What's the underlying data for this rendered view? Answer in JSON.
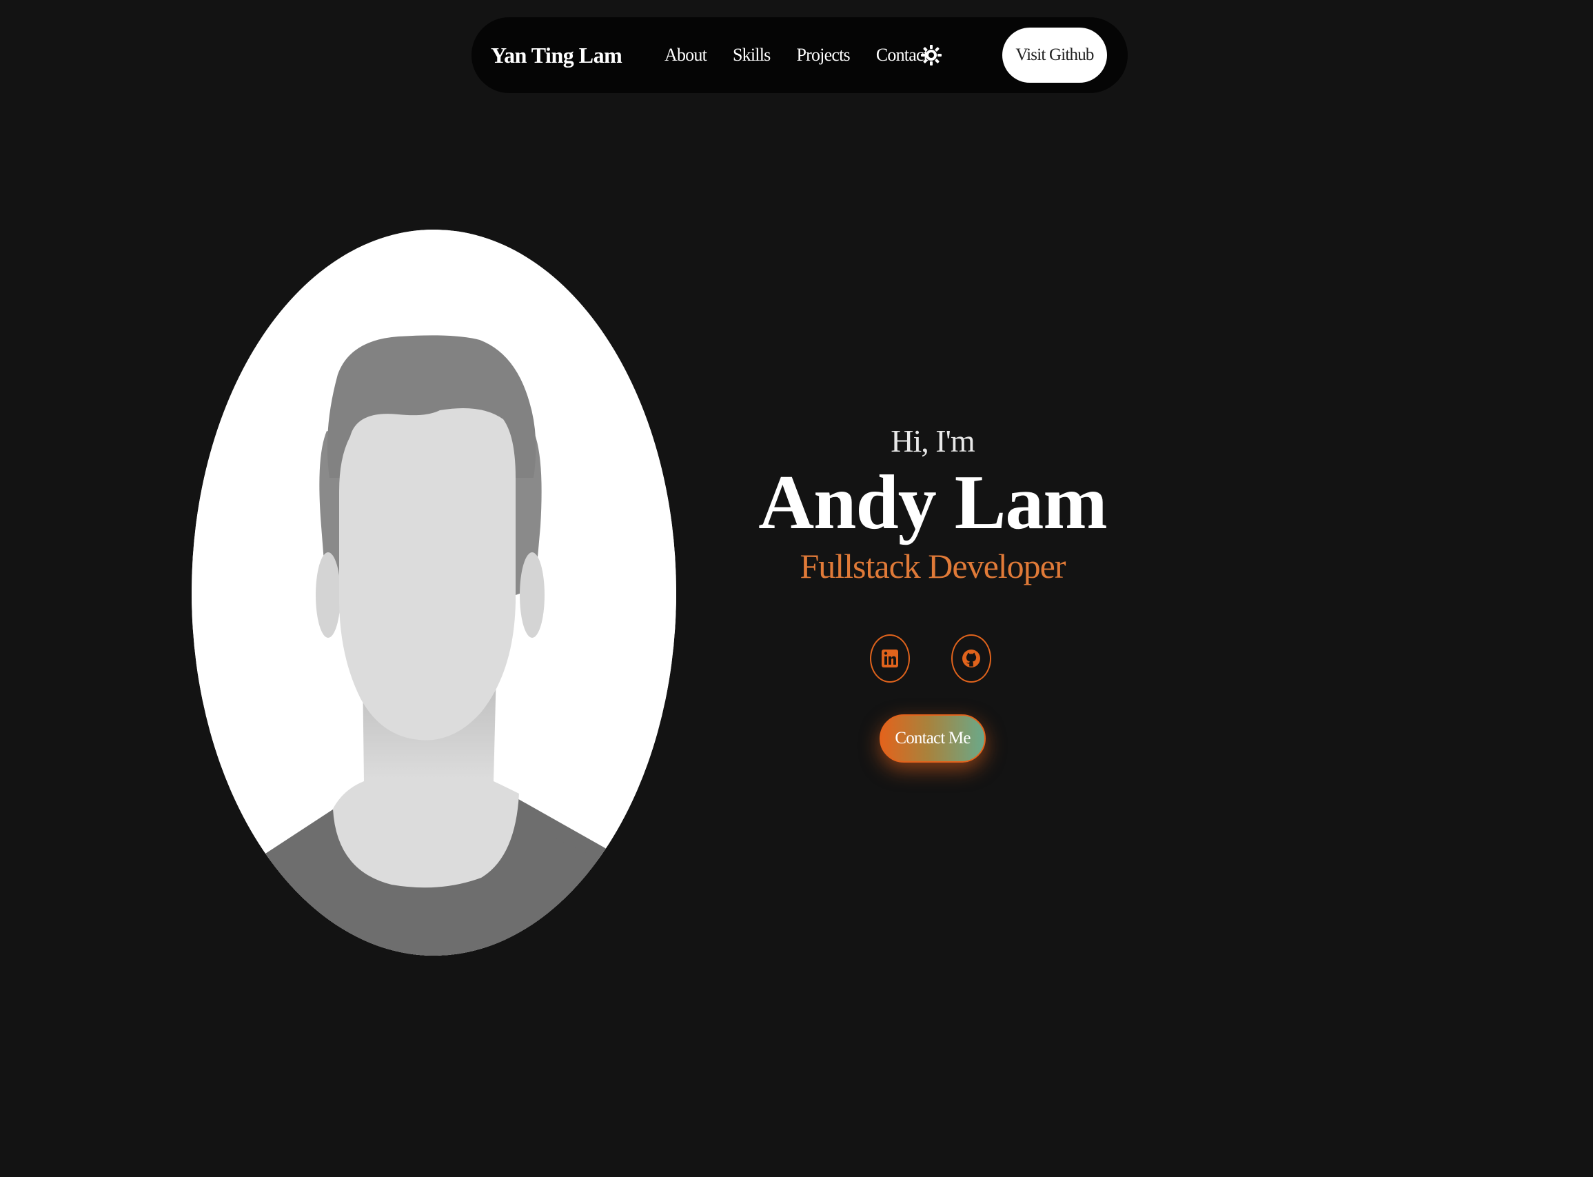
{
  "nav": {
    "brand": "Yan Ting Lam",
    "links": [
      "About",
      "Skills",
      "Projects",
      "Contact"
    ],
    "theme_toggle_icon": "sun-icon",
    "github_button": "Visit Github"
  },
  "hero": {
    "greeting": "Hi, I'm",
    "name": "Andy Lam",
    "role": "Fullstack Developer",
    "socials": [
      {
        "icon": "linkedin-icon"
      },
      {
        "icon": "github-icon"
      }
    ],
    "contact_button": "Contact Me"
  },
  "colors": {
    "background": "#131313",
    "navbar": "#050505",
    "accent": "#e0631c",
    "role_text": "#e07a38",
    "button_gradient_end": "#6aa98a"
  }
}
